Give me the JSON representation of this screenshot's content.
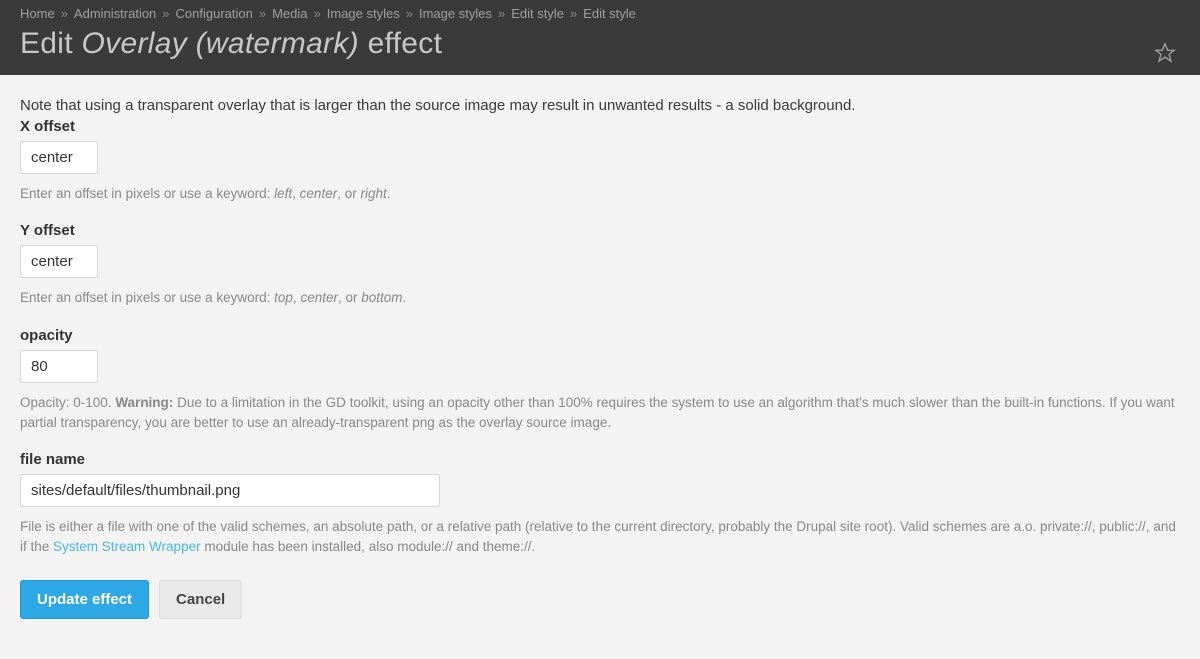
{
  "breadcrumb": {
    "items": [
      {
        "label": "Home"
      },
      {
        "label": "Administration"
      },
      {
        "label": "Configuration"
      },
      {
        "label": "Media"
      },
      {
        "label": "Image styles"
      },
      {
        "label": "Image styles"
      },
      {
        "label": "Edit style"
      },
      {
        "label": "Edit style"
      }
    ],
    "separator": "»"
  },
  "page_title": {
    "prefix": "Edit ",
    "italic": "Overlay (watermark)",
    "suffix": " effect"
  },
  "note": "Note that using a transparent overlay that is larger than the source image may result in unwanted results - a solid background.",
  "fields": {
    "x_offset": {
      "label": "X offset",
      "value": "center",
      "desc_prefix": "Enter an offset in pixels or use a keyword: ",
      "kw1": "left",
      "kw2": "center",
      "kw3": "right",
      "sep1": ", ",
      "sep2": ", or ",
      "period": "."
    },
    "y_offset": {
      "label": "Y offset",
      "value": "center",
      "desc_prefix": "Enter an offset in pixels or use a keyword: ",
      "kw1": "top",
      "kw2": "center",
      "kw3": "bottom",
      "sep1": ", ",
      "sep2": ", or ",
      "period": "."
    },
    "opacity": {
      "label": "opacity",
      "value": "80",
      "desc_prefix": "Opacity: 0-100. ",
      "warning_label": "Warning:",
      "warning_text": " Due to a limitation in the GD toolkit, using an opacity other than 100% requires the system to use an algorithm that's much slower than the built-in functions. If you want partial transparency, you are better to use an already-transparent png as the overlay source image."
    },
    "file_name": {
      "label": "file name",
      "value": "sites/default/files/thumbnail.png",
      "desc_prefix": "File is either a file with one of the valid schemes, an absolute path, or a relative path (relative to the current directory, probably the Drupal site root). Valid schemes are a.o. private://, public://, and if the ",
      "link_text": "System Stream Wrapper",
      "desc_suffix": " module has been installed, also module:// and theme://."
    }
  },
  "actions": {
    "primary": "Update effect",
    "cancel": "Cancel"
  }
}
